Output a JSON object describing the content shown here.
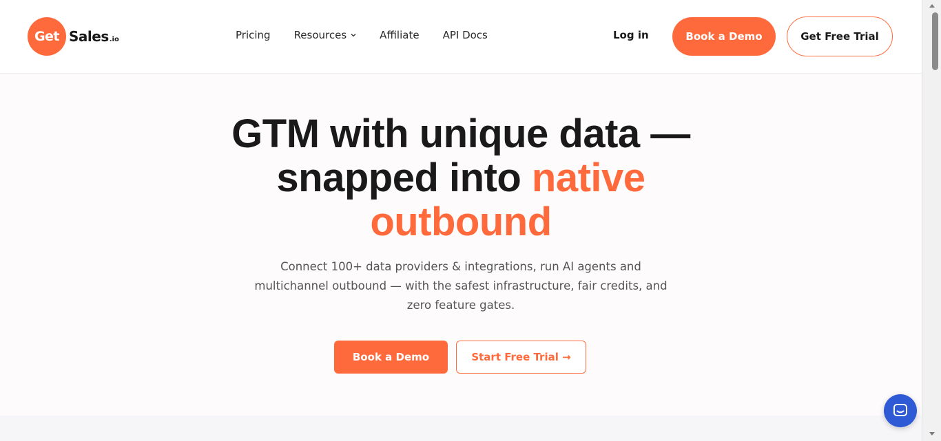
{
  "brand": {
    "logo_circle": "Get",
    "logo_text": "Sales",
    "logo_suffix": ".io",
    "accent_color": "#ff6a3d"
  },
  "nav": {
    "items": [
      {
        "label": "Pricing"
      },
      {
        "label": "Resources",
        "has_dropdown": true,
        "dropdown_icon": "chevron-down-icon"
      },
      {
        "label": "Affiliate"
      },
      {
        "label": "API Docs"
      }
    ]
  },
  "header_actions": {
    "login_label": "Log in",
    "book_demo_label": "Book a Demo",
    "free_trial_label": "Get Free Trial"
  },
  "hero": {
    "headline_line1": "GTM with unique data —",
    "headline_line2_plain": "snapped into ",
    "headline_line2_accent": "native",
    "headline_line3_accent": "outbound",
    "subtext": "Connect 100+ data providers & integrations, run AI agents and multichannel outbound — with the safest infrastructure, fair credits, and zero feature gates.",
    "book_demo_label": "Book a Demo",
    "start_trial_label": "Start Free Trial →"
  },
  "chat_widget": {
    "icon": "chat-bubble-icon",
    "color": "#2f5ad6"
  }
}
